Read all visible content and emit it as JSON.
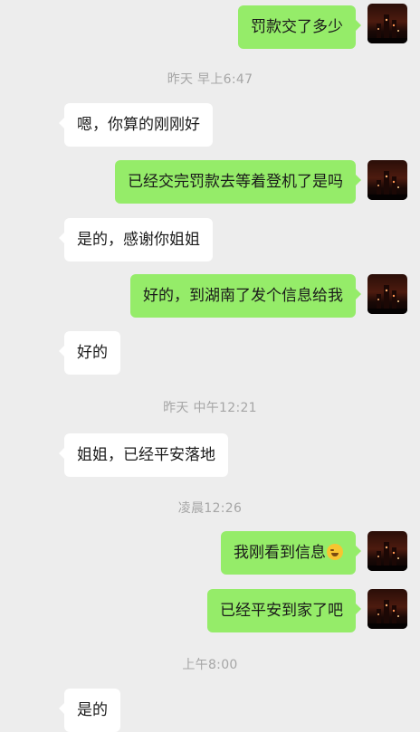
{
  "chat": {
    "messages": [
      {
        "side": "out",
        "text": "罚款交了多少"
      },
      {
        "side": "timestamp",
        "text": "昨天 早上6:47"
      },
      {
        "side": "in",
        "text": "嗯，你算的刚刚好"
      },
      {
        "side": "out",
        "text": "已经交完罚款去等着登机了是吗"
      },
      {
        "side": "in",
        "text": "是的，感谢你姐姐"
      },
      {
        "side": "out",
        "text": "好的，到湖南了发个信息给我"
      },
      {
        "side": "in",
        "text": "好的"
      },
      {
        "side": "timestamp",
        "text": "昨天 中午12:21"
      },
      {
        "side": "in",
        "text": "姐姐，已经平安落地"
      },
      {
        "side": "timestamp",
        "text": "凌晨12:26"
      },
      {
        "side": "out",
        "text": "我刚看到信息",
        "emoji": "laughing-crying-emoji"
      },
      {
        "side": "out",
        "text": "已经平安到家了吧"
      },
      {
        "side": "timestamp",
        "text": "上午8:00"
      },
      {
        "side": "in",
        "text": "是的"
      }
    ]
  },
  "colors": {
    "background": "#ededed",
    "incoming_bubble": "#ffffff",
    "outgoing_bubble": "#95ec69",
    "timestamp_text": "#a6a6a6"
  }
}
